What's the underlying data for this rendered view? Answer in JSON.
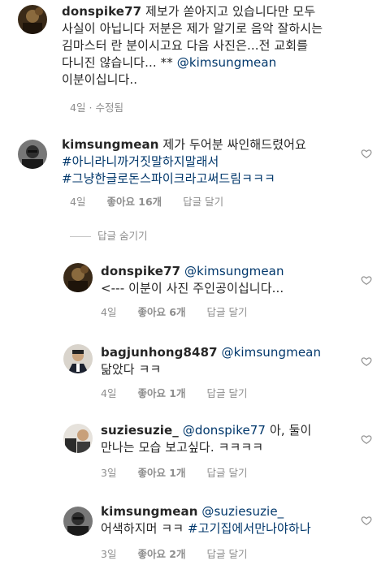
{
  "comments": [
    {
      "username": "donspike77",
      "text_lines": [
        "제보가 쏟아지고 있습니다만 모두",
        "사실이 아닙니다 저분은 제가 알기로 음악 잘하시는",
        "김마스터 란 분이시고요 다음 사진은...전 교회를",
        "다니진 않습니다... ** "
      ],
      "mention_end": "@kimsungmean",
      "text_end": "이분이십니다..",
      "time": "4일",
      "edited": "수정됨"
    },
    {
      "username": "kimsungmean",
      "text": "제가 두어분 싸인해드렸어요",
      "hashtag1": "#아니라니까거짓말하지말래서",
      "hashtag2": "#그냥한글로돈스파이크라고써드림ㅋㅋㅋ",
      "time": "4일",
      "likes": "좋아요 16개",
      "reply": "답글 달기"
    }
  ],
  "hide_replies": "답글 숨기기",
  "replies": [
    {
      "username": "donspike77",
      "mention": "@kimsungmean",
      "text": "<--- 이분이 사진 주인공이십니다...",
      "time": "4일",
      "likes": "좋아요 6개",
      "reply": "답글 달기"
    },
    {
      "username": "bagjunhong8487",
      "mention": "@kimsungmean",
      "text": "닮았다 ㅋㅋ",
      "time": "4일",
      "likes": "좋아요 1개",
      "reply": "답글 달기"
    },
    {
      "username": "suziesuzie_",
      "mention": "@donspike77",
      "text_inline": "아, 둘이",
      "text": "만나는 모습 보고싶다. ㅋㅋㅋㅋ",
      "time": "3일",
      "likes": "좋아요 1개",
      "reply": "답글 달기"
    },
    {
      "username": "kimsungmean",
      "mention": "@suziesuzie_",
      "text_pre": "어색하지머 ㅋㅋ ",
      "hashtag": "#고기집에서만나야하나",
      "time": "3일",
      "likes": "좋아요 2개",
      "reply": "답글 달기"
    }
  ],
  "colors": {
    "text": "#262626",
    "meta": "#8e8e8e",
    "link": "#00376b"
  },
  "icons": {
    "like": "heart-outline-icon"
  }
}
